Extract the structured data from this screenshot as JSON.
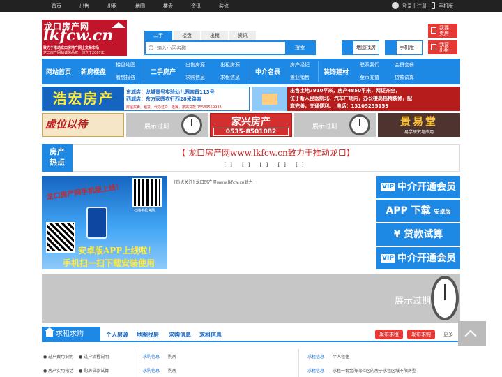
{
  "topbar": {
    "items": [
      "首页",
      "出售",
      "出租",
      "地图",
      "楼盘",
      "资讯",
      "装修"
    ],
    "login": "登录",
    "sep": "|",
    "register": "注册",
    "mobile": "手机版"
  },
  "logo": {
    "line1": "龙口房产网",
    "line2": "lkfcw.cn",
    "slogan": "致力于推动龙口房地产网上交易市场",
    "tagline": "龙口房产网站诚信品牌　创立于2007年"
  },
  "search": {
    "tabs": [
      "二手",
      "楼盘",
      "出租",
      "资讯"
    ],
    "placeholder": "输入小区名称",
    "button": "搜索"
  },
  "header_buttons": {
    "map": "地图找房",
    "mobile": "手机版",
    "sell": [
      "我要",
      "卖房"
    ],
    "rent": [
      "我要",
      "出租"
    ]
  },
  "nav": {
    "home": "网站首页",
    "new": "新房楼盘",
    "new_sub": [
      "楼盘地图",
      "看房报名"
    ],
    "second": "二手房产",
    "second_sub": [
      "出售房源",
      "求购信息"
    ],
    "rent_sub": [
      "出租房源",
      "求租信息"
    ],
    "agency": "中介名录",
    "agency_sub": [
      "房产经纪",
      "置业销售"
    ],
    "decor": "装饰建材",
    "decor_sub": [
      "联系我们",
      "金币充值"
    ],
    "service_sub": [
      "会员套餐",
      "贷款试算"
    ]
  },
  "ads": {
    "haohong": {
      "brand": "浩宏房产",
      "east": "东城店：龙城壹号实验幼儿园南首113号",
      "west": "西城店：东方家园农行西28米路南",
      "small": "房屋买卖、租赁、代办过户、抵押，按揭贷款 15589559938"
    },
    "sale": {
      "l1": "出售土地7910平米，房产4850平米，两证齐全，",
      "l2": "位于新人民医院北、汽车广场内，办公楼高档精装修，配",
      "l3": "套完善，交通便利。　电话：13105255159"
    },
    "xiangbi": "虚位以待",
    "expired": "展示过期",
    "jiaxing": {
      "name": "家兴房产",
      "phone": "0535-8501082"
    },
    "jingyi": {
      "name": "景易堂",
      "sub": "易学研究与应用"
    }
  },
  "hot": {
    "label": [
      "房产",
      "热点"
    ],
    "title": "【 龙口房产网www.lkfcw.cn致力于推动龙口】",
    "dots": "[] [] [] [] []",
    "news": "[热点关注] 龙口房产网www.lkfcw.cn致力"
  },
  "banner": {
    "l1": "龙口房产网手机版上线！",
    "l2": "安卓版APP上线啦！",
    "l3": "手机扫一扫下载安装使用",
    "scan": "扫描手机官网"
  },
  "side_buttons": {
    "vip": "VIP",
    "member": "中介开通会员",
    "app": "APP 下载",
    "android": "安卓版",
    "loan": "¥ 贷款试算"
  },
  "wide_ad": "展示过期",
  "section": {
    "title": "求租求购",
    "tabs": [
      "个人房源",
      "地图找房",
      "求购信息",
      "求租信息"
    ],
    "publish_rent": "发布求租",
    "publish_buy": "发布求购",
    "more": "更多"
  },
  "footer": {
    "left": [
      [
        "过户费用说明",
        "过户流程说明"
      ],
      [
        "房产实用电话",
        "购房贷款试算"
      ]
    ],
    "mid": [
      {
        "tag": "求购信息",
        "text": "购房"
      },
      {
        "tag": "求购信息",
        "text": "购房"
      }
    ],
    "right": [
      {
        "tag": "求租信息",
        "text": "个人租住"
      },
      {
        "tag": "求租信息",
        "text": "求租一套金海湾社区的房子求租区域不限房型"
      }
    ]
  },
  "colors": {
    "brand_blue": "#1e88e5",
    "brand_red": "#c0152a",
    "top_bar": "#222222"
  }
}
